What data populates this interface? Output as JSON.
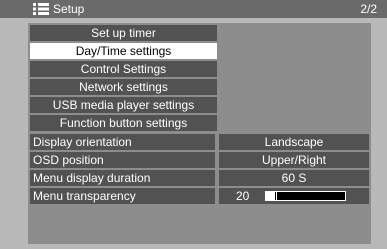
{
  "header": {
    "title": "Setup",
    "page": "2/2",
    "icon": "menu-list-icon"
  },
  "menu": {
    "items": [
      {
        "label": "Set up timer",
        "selected": false
      },
      {
        "label": "Day/Time settings",
        "selected": true
      },
      {
        "label": "Control Settings",
        "selected": false
      },
      {
        "label": "Network settings",
        "selected": false
      },
      {
        "label": "USB media player settings",
        "selected": false
      },
      {
        "label": "Function button settings",
        "selected": false
      }
    ]
  },
  "settings": {
    "display_orientation": {
      "label": "Display orientation",
      "value": "Landscape"
    },
    "osd_position": {
      "label": "OSD position",
      "value": "Upper/Right"
    },
    "menu_display_duration": {
      "label": "Menu display duration",
      "value": "60 S"
    },
    "menu_transparency": {
      "label": "Menu transparency",
      "value": "20",
      "level": 0.2
    }
  },
  "colors": {
    "background": "#b9b9b9",
    "topbar": "#6a6a6a",
    "panel": "#8d8d8d",
    "item": "#525252",
    "selected": "#ffffff"
  }
}
